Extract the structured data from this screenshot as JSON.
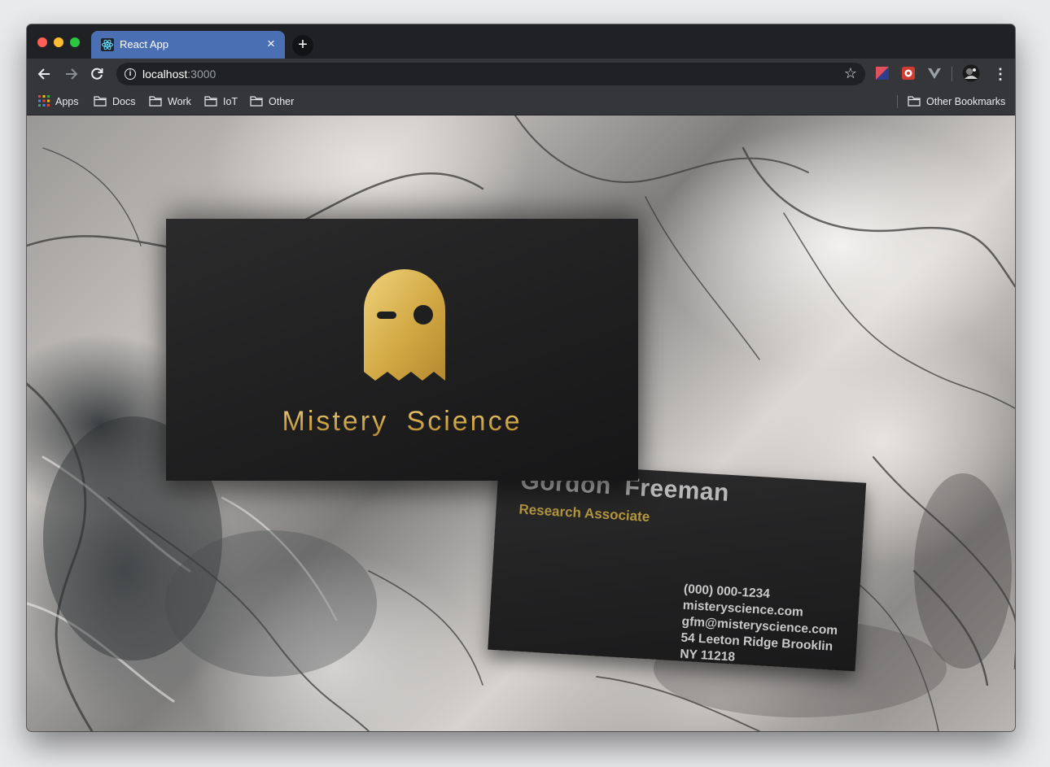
{
  "browser": {
    "tab": {
      "title": "React App",
      "favicon": "react-atom-icon"
    },
    "address_bar": {
      "host": "localhost",
      "port": ":3000"
    },
    "bookmarks": {
      "apps": "Apps",
      "items": [
        "Docs",
        "Work",
        "IoT",
        "Other"
      ],
      "other": "Other Bookmarks"
    },
    "colors": {
      "tab_active": "#4b6fb3",
      "frame": "#202124",
      "toolbar": "#35363a"
    }
  },
  "page": {
    "front_card": {
      "brand": "Mistery  Science",
      "logo": "ghost-logo-icon"
    },
    "back_card": {
      "name": "Gordon  Freeman",
      "title": "Research Associate",
      "contact": [
        "(000) 000-1234",
        "misteryscience.com",
        "gfm@misteryscience.com",
        "54 Leeton Ridge Brooklin",
        "NY 11218"
      ]
    },
    "colors": {
      "gold": "#d9b24e",
      "card": "#1f1f20"
    }
  }
}
